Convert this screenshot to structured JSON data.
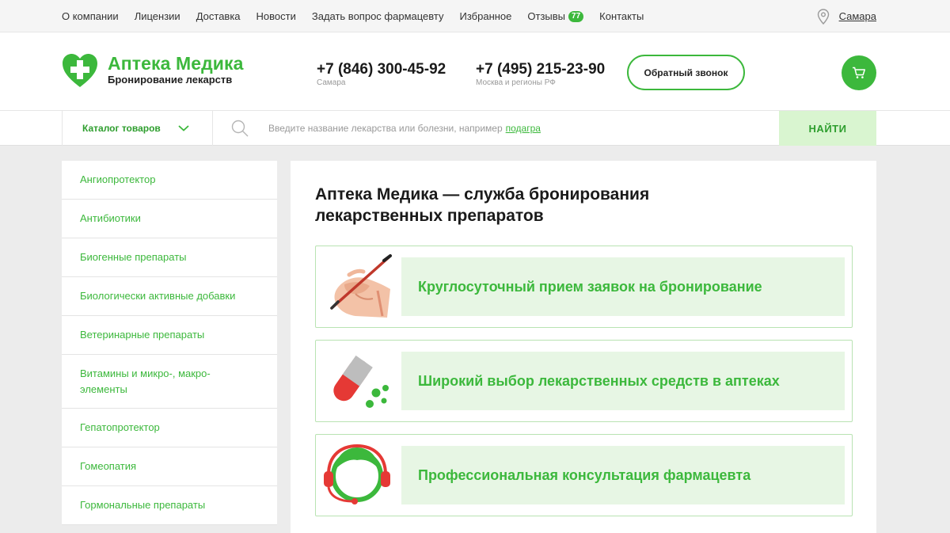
{
  "topnav": {
    "items": [
      "О компании",
      "Лицензии",
      "Доставка",
      "Новости",
      "Задать вопрос фармацевту",
      "Избранное",
      "Отзывы",
      "Контакты"
    ],
    "reviews_count": "77",
    "city": "Самара"
  },
  "header": {
    "logo_title": "Аптека Медика",
    "logo_subtitle": "Бронирование лекарств",
    "phones": [
      {
        "number": "+7 (846) 300-45-92",
        "region": "Самара"
      },
      {
        "number": "+7 (495) 215-23-90",
        "region": "Москва и регионы РФ"
      }
    ],
    "callback_label": "Обратный звонок"
  },
  "search": {
    "catalog_label": "Каталог товаров",
    "placeholder": "Введите название лекарства или болезни, например",
    "example": "подагра",
    "button_label": "НАЙТИ"
  },
  "sidebar": {
    "items": [
      "Ангиопротектор",
      "Антибиотики",
      "Биогенные препараты",
      "Биологически активные добавки",
      "Ветеринарные препараты",
      "Витамины и микро-, макро-\nэлементы",
      "Гепатопротектор",
      "Гомеопатия",
      "Гормональные препараты"
    ]
  },
  "main": {
    "title": "Аптека Медика — служба бронирования лекарственных препаратов",
    "features": [
      {
        "icon": "hand-writing-icon",
        "text": "Круглосуточный прием заявок на бронирование"
      },
      {
        "icon": "pill-capsule-icon",
        "text": "Широкий выбор лекарственных средств в аптеках"
      },
      {
        "icon": "headset-operator-icon",
        "text": "Профессиональная консультация фармацевта"
      }
    ]
  },
  "colors": {
    "brand_green": "#3cb83c",
    "light_green": "#e7f6e4",
    "button_green_bg": "#d9f5d0",
    "pill_red": "#e53935"
  }
}
